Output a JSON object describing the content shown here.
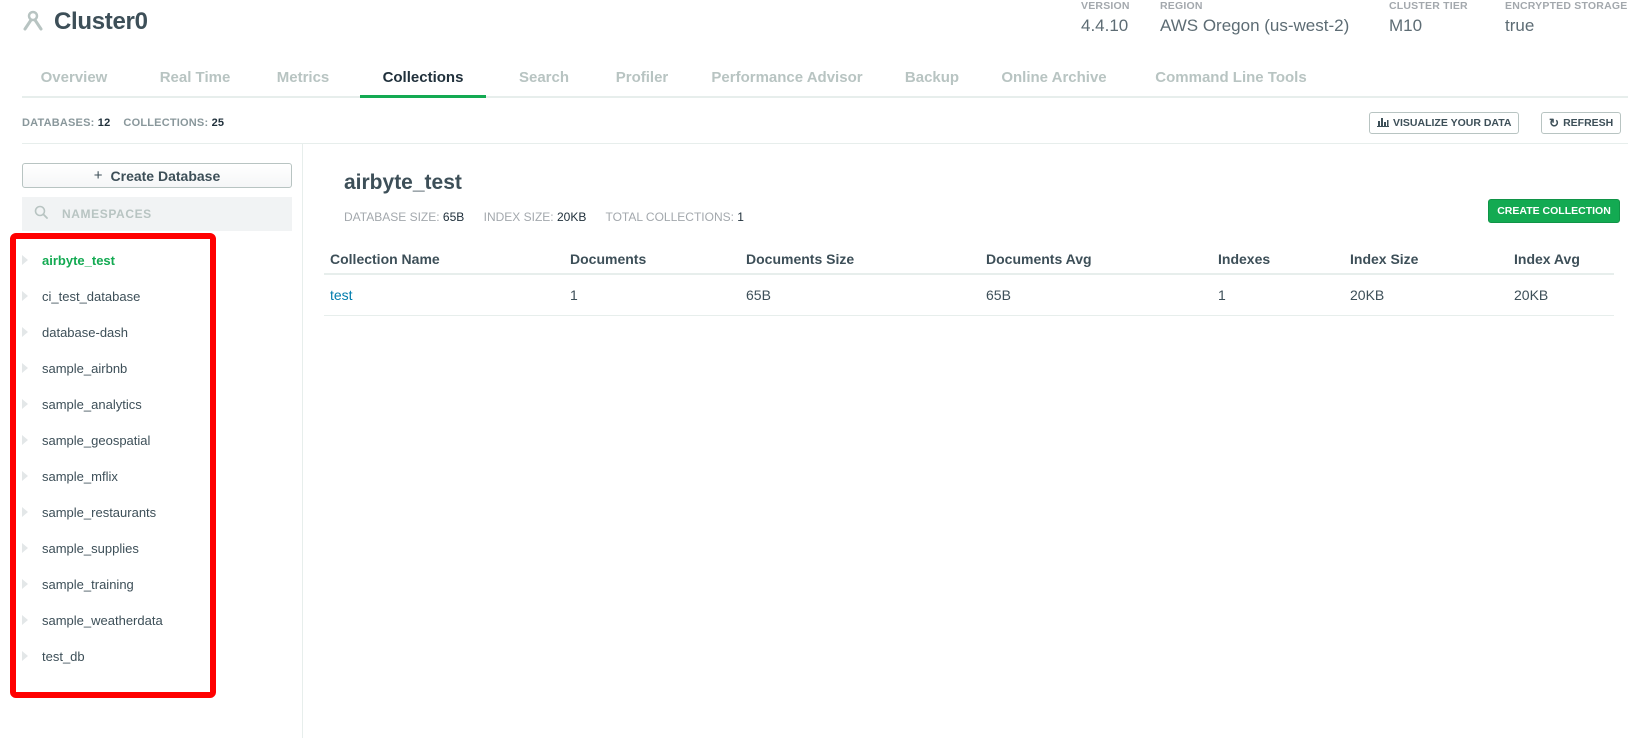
{
  "cluster": {
    "name": "Cluster0"
  },
  "meta": [
    {
      "label": "VERSION",
      "value": "4.4.10"
    },
    {
      "label": "REGION",
      "value": "AWS Oregon (us-west-2)"
    },
    {
      "label": "CLUSTER TIER",
      "value": "M10"
    },
    {
      "label": "ENCRYPTED STORAGE",
      "value": "true"
    }
  ],
  "tabs": [
    {
      "label": "Overview"
    },
    {
      "label": "Real Time"
    },
    {
      "label": "Metrics"
    },
    {
      "label": "Collections",
      "active": true
    },
    {
      "label": "Search"
    },
    {
      "label": "Profiler"
    },
    {
      "label": "Performance Advisor"
    },
    {
      "label": "Backup"
    },
    {
      "label": "Online Archive"
    },
    {
      "label": "Command Line Tools"
    }
  ],
  "summary": {
    "databases_label": "DATABASES:",
    "databases_count": "12",
    "collections_label": "COLLECTIONS:",
    "collections_count": "25"
  },
  "toolbar": {
    "visualize_label": "VISUALIZE YOUR DATA",
    "refresh_label": "REFRESH"
  },
  "sidebar": {
    "create_db_label": "Create Database",
    "search_placeholder": "NAMESPACES",
    "databases": [
      {
        "name": "airbyte_test",
        "active": true
      },
      {
        "name": "ci_test_database"
      },
      {
        "name": "database-dash"
      },
      {
        "name": "sample_airbnb"
      },
      {
        "name": "sample_analytics"
      },
      {
        "name": "sample_geospatial"
      },
      {
        "name": "sample_mflix"
      },
      {
        "name": "sample_restaurants"
      },
      {
        "name": "sample_supplies"
      },
      {
        "name": "sample_training"
      },
      {
        "name": "sample_weatherdata"
      },
      {
        "name": "test_db"
      }
    ]
  },
  "main": {
    "title": "airbyte_test",
    "stats": {
      "db_size_label": "DATABASE SIZE:",
      "db_size": "65B",
      "index_size_label": "INDEX SIZE:",
      "index_size": "20KB",
      "total_collections_label": "TOTAL COLLECTIONS:",
      "total_collections": "1"
    },
    "create_collection_label": "CREATE COLLECTION",
    "table": {
      "headers": [
        "Collection Name",
        "Documents",
        "Documents Size",
        "Documents Avg",
        "Indexes",
        "Index Size",
        "Index Avg"
      ],
      "rows": [
        [
          "test",
          "1",
          "65B",
          "65B",
          "1",
          "20KB",
          "20KB"
        ]
      ]
    }
  },
  "colors": {
    "accent": "#13aa52",
    "link": "#007cad",
    "highlight": "#ff0000"
  }
}
